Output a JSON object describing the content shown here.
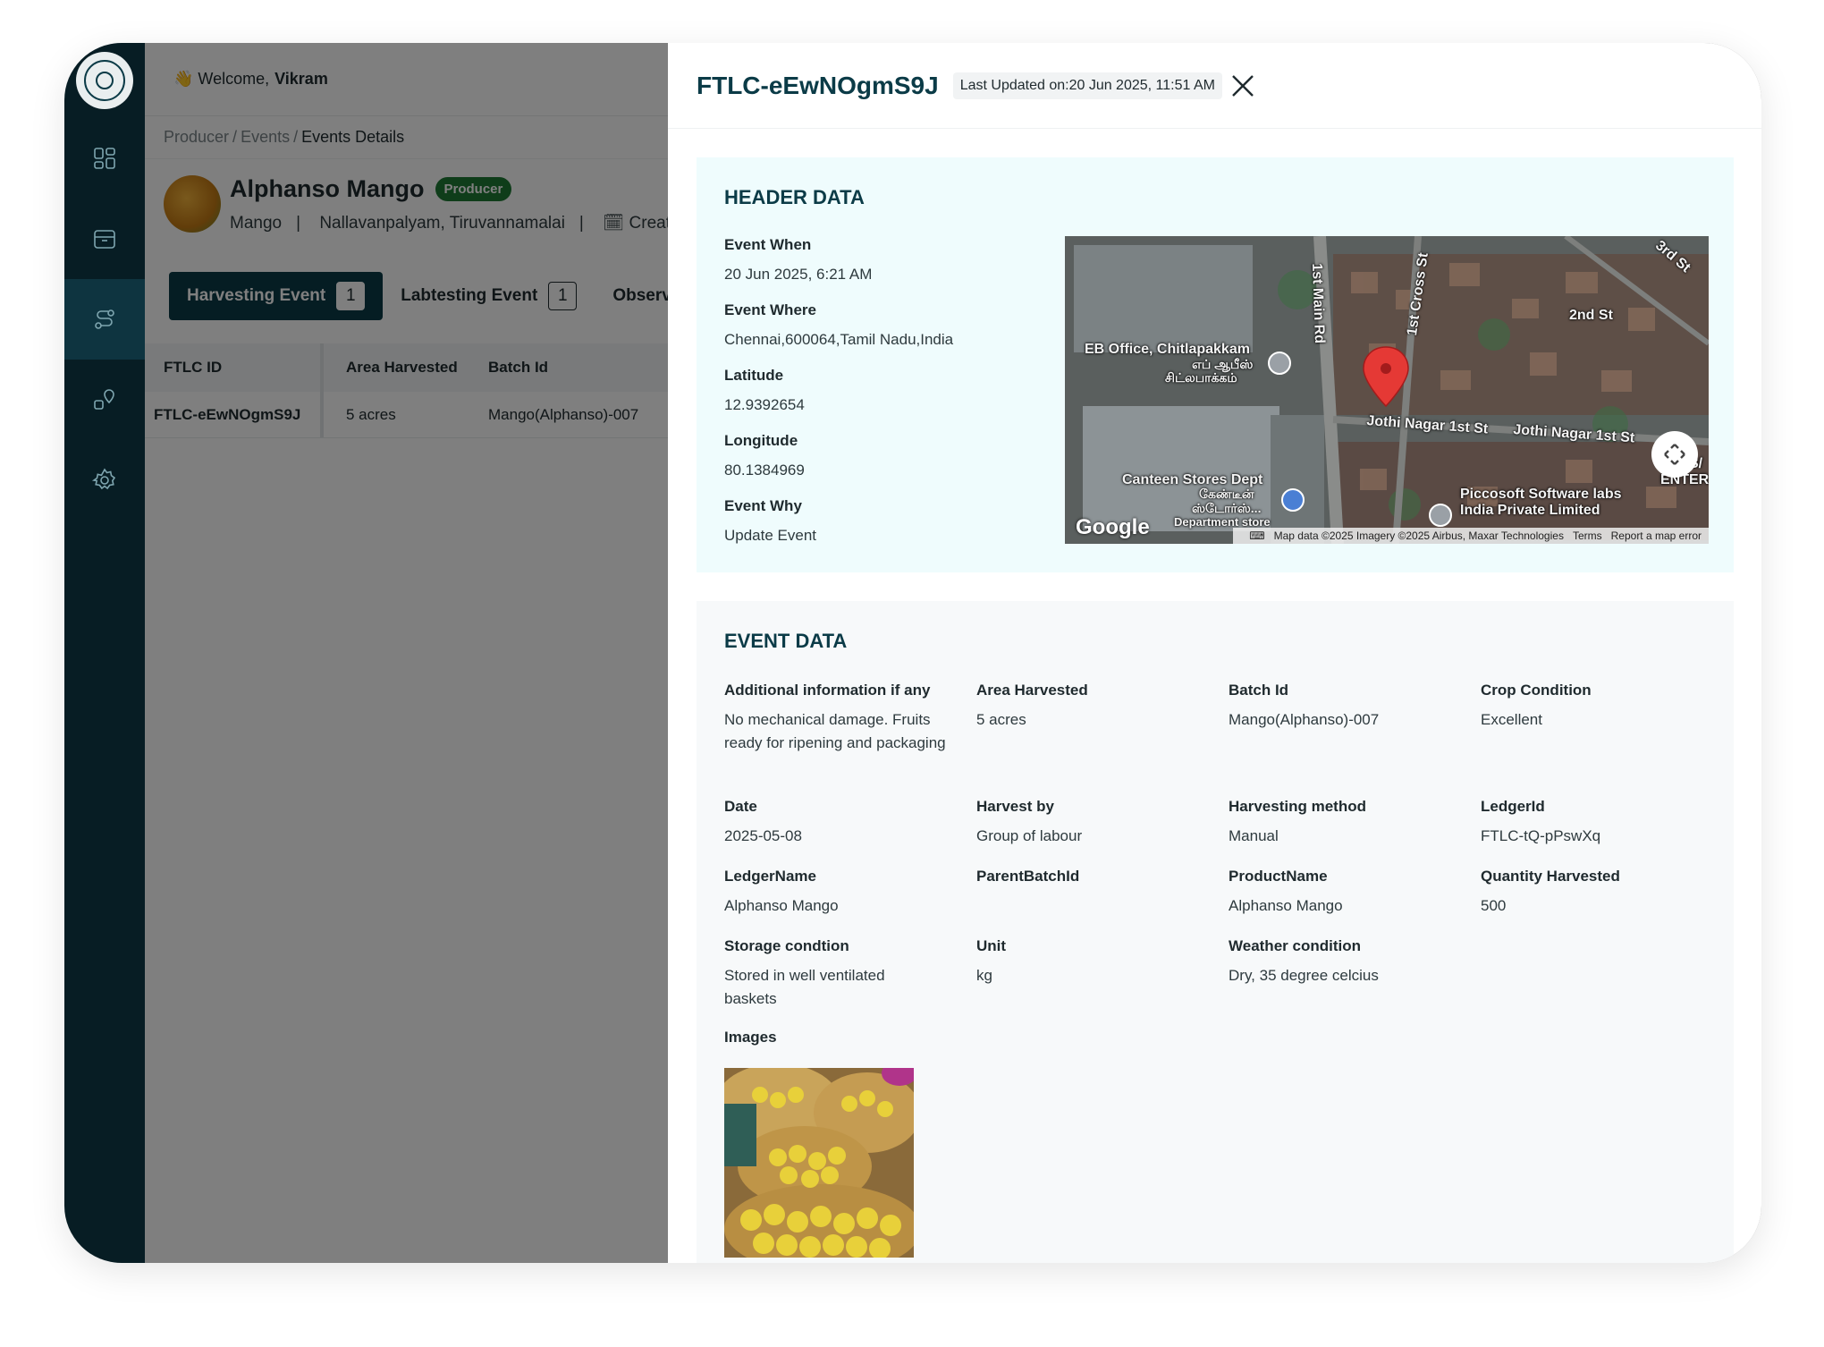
{
  "welcome": {
    "prefix": "👋 Welcome,",
    "name": "Vikram"
  },
  "breadcrumb": [
    "Producer",
    "Events",
    "Events Details"
  ],
  "profile": {
    "name": "Alphanso Mango",
    "badge": "Producer",
    "crop": "Mango",
    "location": "Nallavanpalyam, Tiruvannamalai",
    "created": "Creat"
  },
  "tabs": [
    {
      "label": "Harvesting Event",
      "count": "1"
    },
    {
      "label": "Labtesting Event",
      "count": "1"
    },
    {
      "label": "Observ",
      "count": ""
    }
  ],
  "table": {
    "headers": [
      "FTLC ID",
      "Area Harvested",
      "Batch Id"
    ],
    "rows": [
      [
        "FTLC-eEwNOgmS9J",
        "5 acres",
        "Mango(Alphanso)-007"
      ]
    ]
  },
  "drawer": {
    "title": "FTLC-eEwNOgmS9J",
    "last_updated": "Last Updated on:20 Jun 2025, 11:51 AM"
  },
  "header_data": {
    "title": "HEADER DATA",
    "fields": [
      {
        "label": "Event When",
        "value": "20 Jun 2025, 6:21 AM"
      },
      {
        "label": "Event Where",
        "value": "Chennai,600064,Tamil Nadu,India"
      },
      {
        "label": "Latitude",
        "value": "12.9392654"
      },
      {
        "label": "Longitude",
        "value": "80.1384969"
      },
      {
        "label": "Event Why",
        "value": "Update Event"
      }
    ]
  },
  "map": {
    "labels": [
      "1st Main Rd",
      "1st Cross St",
      "3rd St",
      "2nd St",
      "EB Office, Chitlapakkam",
      "எப் ஆபீஸ்",
      "சிட்லபாக்கம்",
      "Jothi Nagar 1st St",
      "Jothi Nagar 1st St",
      "Canteen Stores Dept",
      "கேண்டீன்",
      "ஸ்டோர்ஸ்...",
      "Department store",
      "Piccosoft Software labs",
      "India Private Limited",
      "S/",
      "ENTER"
    ],
    "logo": "Google",
    "attribution": "Map data ©2025 Imagery ©2025 Airbus, Maxar Technologies",
    "terms": "Terms",
    "report": "Report a map error"
  },
  "event_data": {
    "title": "EVENT DATA",
    "fields": [
      {
        "label": "Additional information if any",
        "value": "No mechanical damage. Fruits ready for ripening and packaging"
      },
      {
        "label": "Area Harvested",
        "value": "5 acres"
      },
      {
        "label": "Batch Id",
        "value": "Mango(Alphanso)-007"
      },
      {
        "label": "Crop Condition",
        "value": "Excellent"
      },
      {
        "label": "Date",
        "value": "2025-05-08"
      },
      {
        "label": "Harvest by",
        "value": "Group of labour"
      },
      {
        "label": "Harvesting method",
        "value": "Manual"
      },
      {
        "label": "LedgerId",
        "value": "FTLC-tQ-pPswXq"
      },
      {
        "label": "LedgerName",
        "value": "Alphanso Mango"
      },
      {
        "label": "ParentBatchId",
        "value": ""
      },
      {
        "label": "ProductName",
        "value": "Alphanso Mango"
      },
      {
        "label": "Quantity Harvested",
        "value": "500"
      },
      {
        "label": "Storage condtion",
        "value": "Stored in well ventilated baskets"
      },
      {
        "label": "Unit",
        "value": "kg"
      },
      {
        "label": "Weather condition",
        "value": "Dry, 35 degree celcius"
      }
    ],
    "images_label": "Images"
  }
}
